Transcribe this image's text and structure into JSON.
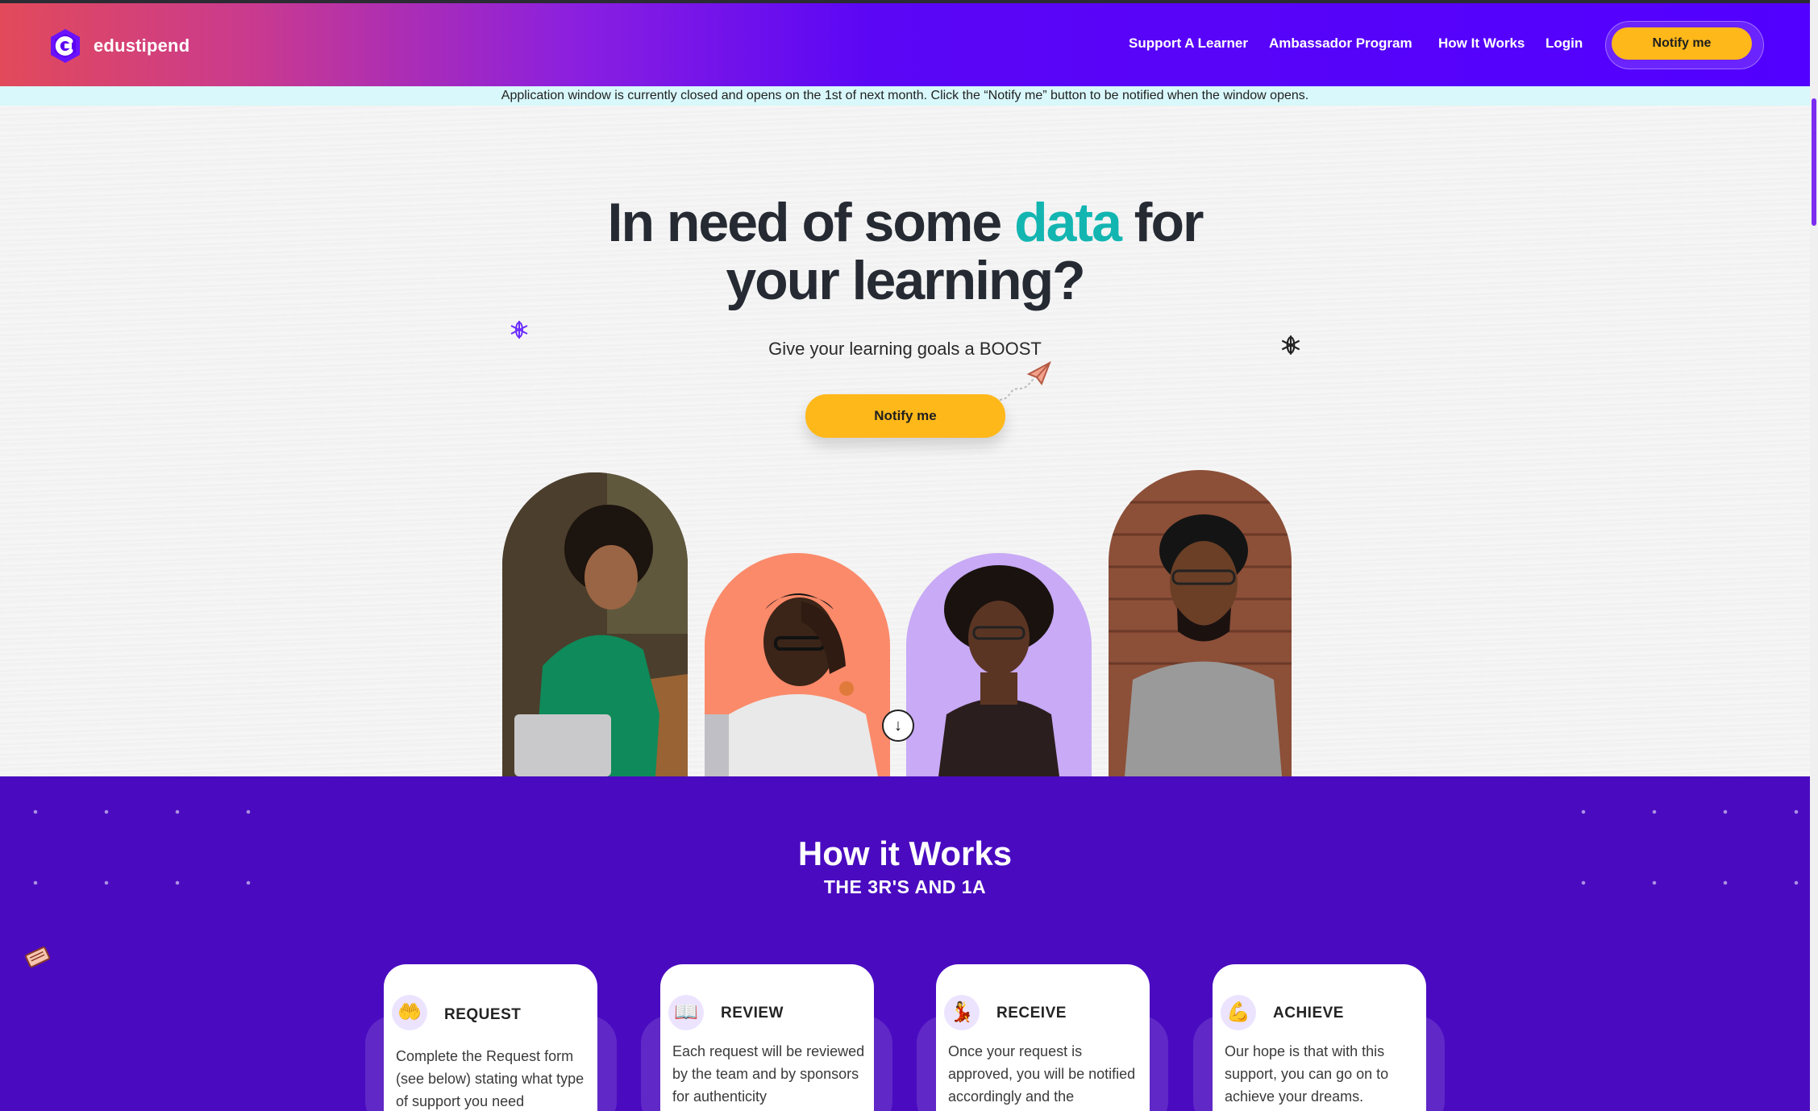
{
  "header": {
    "logo_text": "edustipend",
    "nav": [
      {
        "label": "Support A Learner"
      },
      {
        "label": "Ambassador Program"
      },
      {
        "label": "How It Works"
      },
      {
        "label": "Login"
      }
    ],
    "notify_label": "Notify me"
  },
  "banner": {
    "text": "Application window is currently closed and opens on the 1st of next month. Click the “Notify me” button to be notified when the window opens."
  },
  "hero": {
    "title_part1": "In need of some ",
    "title_accent": "data",
    "title_part2": " for",
    "title_line2": "your learning?",
    "subtitle": "Give your learning goals a BOOST",
    "notify_label": "Notify me",
    "scroll_glyph": "↓"
  },
  "how_it_works": {
    "title": "How it Works",
    "subtitle": "THE 3R'S AND 1A",
    "steps": [
      {
        "icon": "raised-hands-icon",
        "glyph": "🤲",
        "title": "REQUEST",
        "text": "Complete the Request form (see below) stating what type of support you need"
      },
      {
        "icon": "open-book-icon",
        "glyph": "📖",
        "title": "REVIEW",
        "text": "Each request will be reviewed by the team and by sponsors for authenticity"
      },
      {
        "icon": "receive-icon",
        "glyph": "💃",
        "title": "RECEIVE",
        "text": "Once your request is approved, you will be notified accordingly and the"
      },
      {
        "icon": "flexed-biceps-icon",
        "glyph": "💪",
        "title": "ACHIEVE",
        "text": "Our hope is that with this support, you can go on to achieve your dreams."
      }
    ]
  },
  "colors": {
    "accent_teal": "#13b5b1",
    "brand_purple": "#5200ff",
    "section_purple": "#4a0bc0",
    "button_yellow": "#ffb81a"
  }
}
